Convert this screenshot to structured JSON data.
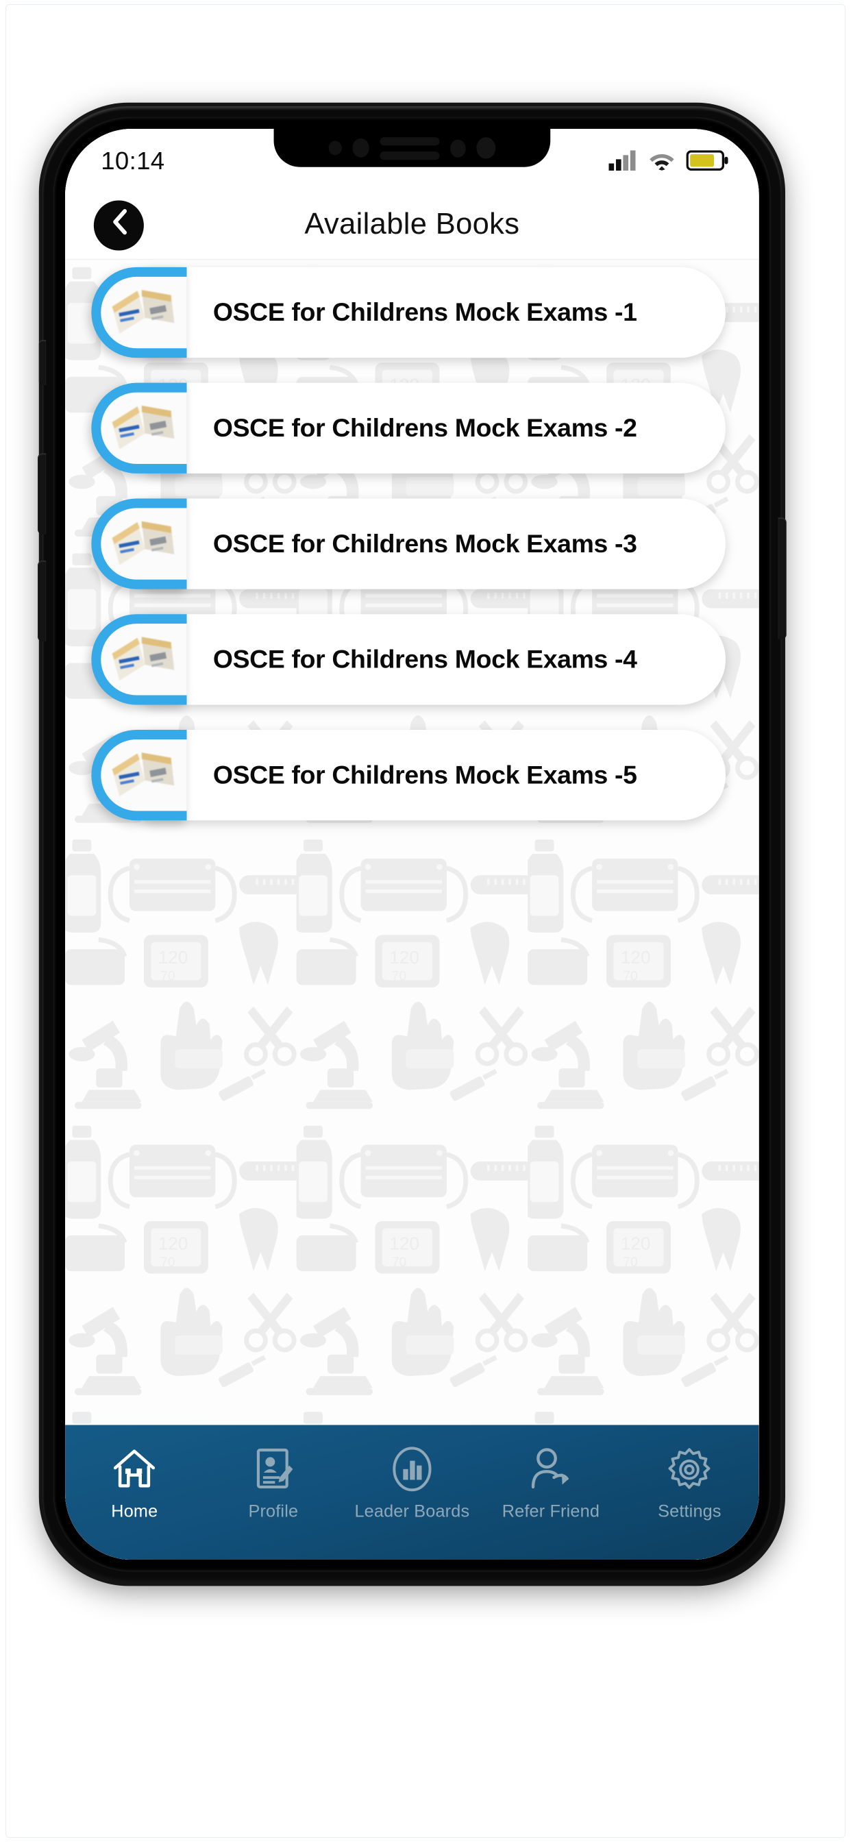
{
  "statusbar": {
    "time": "10:14",
    "signal_icon": "signal-bars-icon",
    "wifi_icon": "wifi-icon",
    "battery_icon": "battery-icon",
    "battery_color": "#d4c31c"
  },
  "header": {
    "title": "Available Books",
    "back_icon": "chevron-left-icon"
  },
  "books": [
    {
      "title": "OSCE for Childrens Mock Exams -1",
      "thumb_icon": "book-thumbnail-icon"
    },
    {
      "title": "OSCE for Childrens Mock Exams -2",
      "thumb_icon": "book-thumbnail-icon"
    },
    {
      "title": "OSCE for Childrens Mock Exams -3",
      "thumb_icon": "book-thumbnail-icon"
    },
    {
      "title": "OSCE for Childrens Mock Exams -4",
      "thumb_icon": "book-thumbnail-icon"
    },
    {
      "title": "OSCE for Childrens Mock Exams -5",
      "thumb_icon": "book-thumbnail-icon"
    }
  ],
  "bottom_nav": {
    "items": [
      {
        "label": "Home",
        "icon": "home-icon",
        "active": true
      },
      {
        "label": "Profile",
        "icon": "profile-card-icon",
        "active": false
      },
      {
        "label": "Leader Boards",
        "icon": "bar-chart-icon",
        "active": false
      },
      {
        "label": "Refer Friend",
        "icon": "person-share-icon",
        "active": false
      },
      {
        "label": "Settings",
        "icon": "gear-icon",
        "active": false
      }
    ]
  },
  "colors": {
    "accent_blue": "#36a9e9",
    "nav_blue_top": "#155b87",
    "nav_blue_bottom": "#0d3f60",
    "nav_inactive": "#8fa8b8",
    "card_white": "#ffffff"
  }
}
